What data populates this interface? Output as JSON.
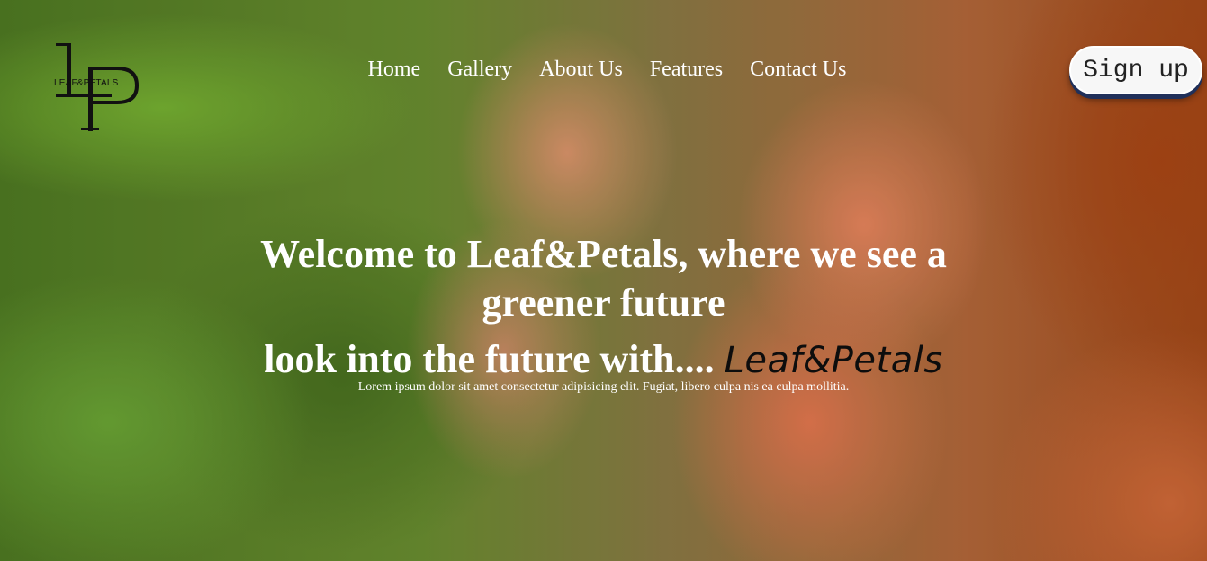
{
  "header": {
    "logo_text": "LEAF&PETALS",
    "nav": [
      "Home",
      "Gallery",
      "About Us",
      "Features",
      "Contact Us"
    ],
    "signup_label": "Sign up"
  },
  "hero": {
    "title": "Welcome to Leaf&Petals, where we see a greener future",
    "subtitle_prefix": "look into the future with....",
    "subtitle_brand": "Leaf&Petals",
    "description": "Lorem ipsum dolor sit amet consectetur adipisicing elit. Fugiat, libero culpa nis ea culpa mollitia."
  },
  "colors": {
    "text_light": "#ffffff",
    "brand_text": "#0d0d0d",
    "button_bg": "#f7f7f7",
    "button_shadow": "#20305a"
  },
  "icons": {
    "logo": "lp-monogram-logo"
  }
}
